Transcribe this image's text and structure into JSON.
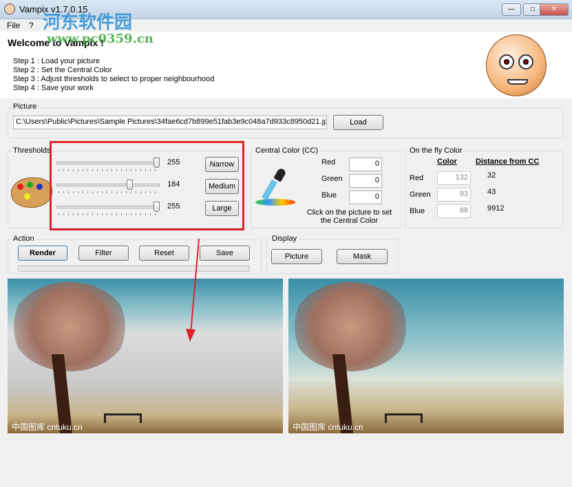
{
  "window": {
    "title": "Vampix v1.7.0.15",
    "controls": [
      "—",
      "□",
      "✕"
    ]
  },
  "menu": [
    "File",
    "?"
  ],
  "watermark": {
    "site_name": "河东软件园",
    "url": "www.pc0359.cn"
  },
  "welcome": {
    "title": "Welcome to Vampix !",
    "steps": [
      "Step 1 : Load your picture",
      "Step 2 : Set the Central Color",
      "Step 3 : Adjust thresholds to select to proper neighbourhood",
      "Step 4 : Save your work"
    ]
  },
  "picture": {
    "label": "Picture",
    "path": "C:\\Users\\Public\\Pictures\\Sample Pictures\\34fae6cd7b899e51fab3e9c048a7d933c8950d21.jp",
    "load": "Load"
  },
  "thresholds": {
    "label": "Thresholds",
    "sliders": [
      {
        "value": "255",
        "level": 255,
        "max": 255,
        "button": "Narrow"
      },
      {
        "value": "184",
        "level": 184,
        "max": 255,
        "button": "Medium"
      },
      {
        "value": "255",
        "level": 255,
        "max": 255,
        "button": "Large"
      }
    ]
  },
  "central": {
    "label": "Central Color (CC)",
    "red_label": "Red",
    "green_label": "Green",
    "blue_label": "Blue",
    "red": "0",
    "green": "0",
    "blue": "0",
    "hint": "Click on the picture to set the Central Color"
  },
  "onfly": {
    "label": "On the fly Color",
    "color_header": "Color",
    "distance_header": "Distance from CC",
    "rows": [
      {
        "label": "Red",
        "value": "132",
        "distance": "32"
      },
      {
        "label": "Green",
        "value": "93",
        "distance": "43"
      },
      {
        "label": "Blue",
        "value": "88",
        "distance": "9912"
      }
    ]
  },
  "action": {
    "label": "Action",
    "buttons": [
      "Render",
      "Filter",
      "Reset",
      "Save"
    ],
    "progress": 0
  },
  "display": {
    "label": "Display",
    "buttons": [
      "Picture",
      "Mask"
    ]
  },
  "images": {
    "caption_left": "中国图库 cntuku.cn",
    "caption_right": "中国图库 cntuku.cn"
  },
  "colors": {
    "annotation": "#e0212c"
  }
}
